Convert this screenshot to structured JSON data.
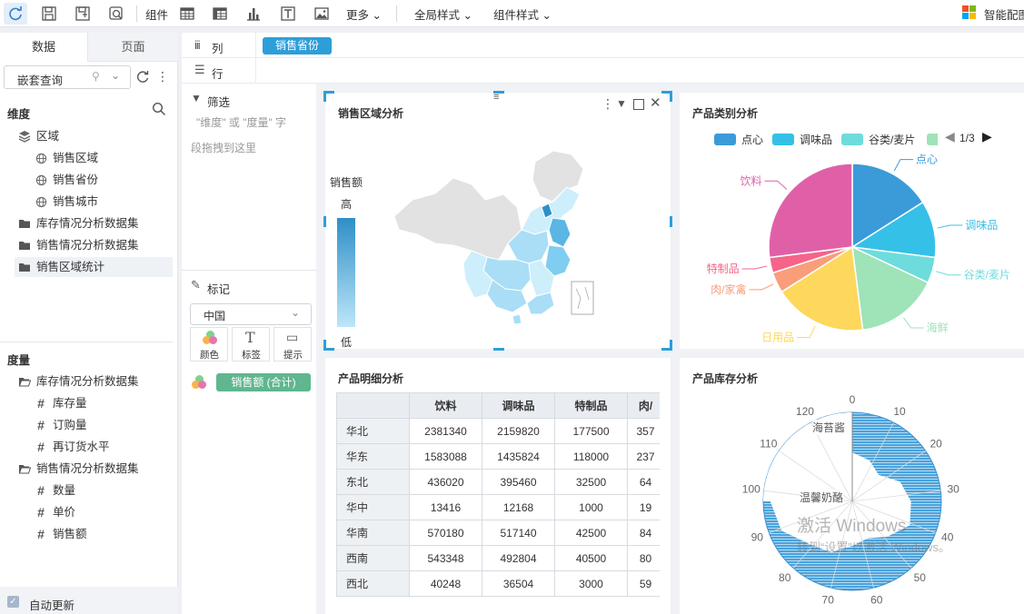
{
  "toolbar": {
    "icons": [
      "refresh-icon",
      "save-icon",
      "save-as-icon",
      "preview-icon"
    ],
    "component_label": "组件",
    "more_label": "更多",
    "global_style_label": "全局样式",
    "component_style_label": "组件样式",
    "smart_label": "智能配图"
  },
  "left_panel": {
    "tabs": [
      "数据",
      "页面"
    ],
    "dataset_select": "嵌套查询",
    "dimension_title": "维度",
    "dimension_tree": [
      {
        "label": "区域",
        "icon": "layers-icon",
        "level": 1
      },
      {
        "label": "销售区域",
        "icon": "globe-icon",
        "level": 2
      },
      {
        "label": "销售省份",
        "icon": "globe-icon",
        "level": 2
      },
      {
        "label": "销售城市",
        "icon": "globe-icon",
        "level": 2
      },
      {
        "label": "库存情况分析数据集",
        "icon": "folder-icon",
        "level": 1
      },
      {
        "label": "销售情况分析数据集",
        "icon": "folder-icon",
        "level": 1
      },
      {
        "label": "销售区域统计",
        "icon": "folder-icon",
        "level": 1
      }
    ],
    "measure_title": "度量",
    "measure_tree": [
      {
        "label": "库存情况分析数据集",
        "icon": "folder-open-icon",
        "level": 1
      },
      {
        "label": "库存量",
        "icon": "hash-icon",
        "level": 2
      },
      {
        "label": "订购量",
        "icon": "hash-icon",
        "level": 2
      },
      {
        "label": "再订货水平",
        "icon": "hash-icon",
        "level": 2
      },
      {
        "label": "销售情况分析数据集",
        "icon": "folder-open-icon",
        "level": 1
      },
      {
        "label": "数量",
        "icon": "hash-icon",
        "level": 2
      },
      {
        "label": "单价",
        "icon": "hash-icon",
        "level": 2
      },
      {
        "label": "销售额",
        "icon": "hash-icon",
        "level": 2
      }
    ],
    "auto_update_label": "自动更新"
  },
  "shelf": {
    "col_label": "列",
    "row_label": "行",
    "col_field": "销售省份"
  },
  "config": {
    "filter_label": "筛选",
    "filter_hint_1": "\"维度\" 或 \"度量\" 字",
    "filter_hint_2": "段拖拽到这里",
    "mark_label": "标记",
    "map_select": "中国",
    "mark_buttons": [
      "颜色",
      "标签",
      "提示"
    ],
    "mark_field": "销售额 (合计)"
  },
  "colors": {
    "accent": "#2e9ed8",
    "pill_green": "#5fb68f"
  },
  "map_card": {
    "title": "销售区域分析",
    "legend_title": "销售额",
    "legend_high": "高",
    "legend_low": "低"
  },
  "pie_card": {
    "title": "产品类别分析",
    "legend": [
      "点心",
      "调味品",
      "谷类/麦片"
    ],
    "legend_page": "1/3",
    "chart_data": {
      "type": "pie",
      "slices": [
        {
          "name": "点心",
          "value": 16,
          "color": "#3a9bd8"
        },
        {
          "name": "调味品",
          "value": 11,
          "color": "#35c0e8"
        },
        {
          "name": "谷类/麦片",
          "value": 5,
          "color": "#6edcdc"
        },
        {
          "name": "海鲜",
          "value": 16,
          "color": "#9fe3b8"
        },
        {
          "name": "日用品",
          "value": 18,
          "color": "#fdd85d"
        },
        {
          "name": "肉/家禽",
          "value": 4,
          "color": "#fa9d7a"
        },
        {
          "name": "特制品",
          "value": 3,
          "color": "#f6648a"
        },
        {
          "name": "饮料",
          "value": 27,
          "color": "#e060a8"
        }
      ]
    }
  },
  "table_card": {
    "title": "产品明细分析",
    "headers": [
      "",
      "饮料",
      "调味品",
      "特制品",
      "肉/"
    ],
    "rows": [
      [
        "华北",
        "2381340",
        "2159820",
        "177500",
        "357"
      ],
      [
        "华东",
        "1583088",
        "1435824",
        "118000",
        "237"
      ],
      [
        "东北",
        "436020",
        "395460",
        "32500",
        "64"
      ],
      [
        "华中",
        "13416",
        "12168",
        "1000",
        "19"
      ],
      [
        "华南",
        "570180",
        "517140",
        "42500",
        "84"
      ],
      [
        "西南",
        "543348",
        "492804",
        "40500",
        "80"
      ],
      [
        "西北",
        "40248",
        "36504",
        "3000",
        "59"
      ]
    ]
  },
  "radar_card": {
    "title": "产品库存分析",
    "ticks": [
      "0",
      "10",
      "20",
      "30",
      "40",
      "50",
      "60",
      "70",
      "80",
      "90",
      "100",
      "110",
      "120"
    ],
    "labels": [
      "海苔酱",
      "温馨奶酪"
    ]
  },
  "watermark": {
    "line1": "激活 Windows",
    "line2": "转到“设置”以激活 Windows。"
  }
}
